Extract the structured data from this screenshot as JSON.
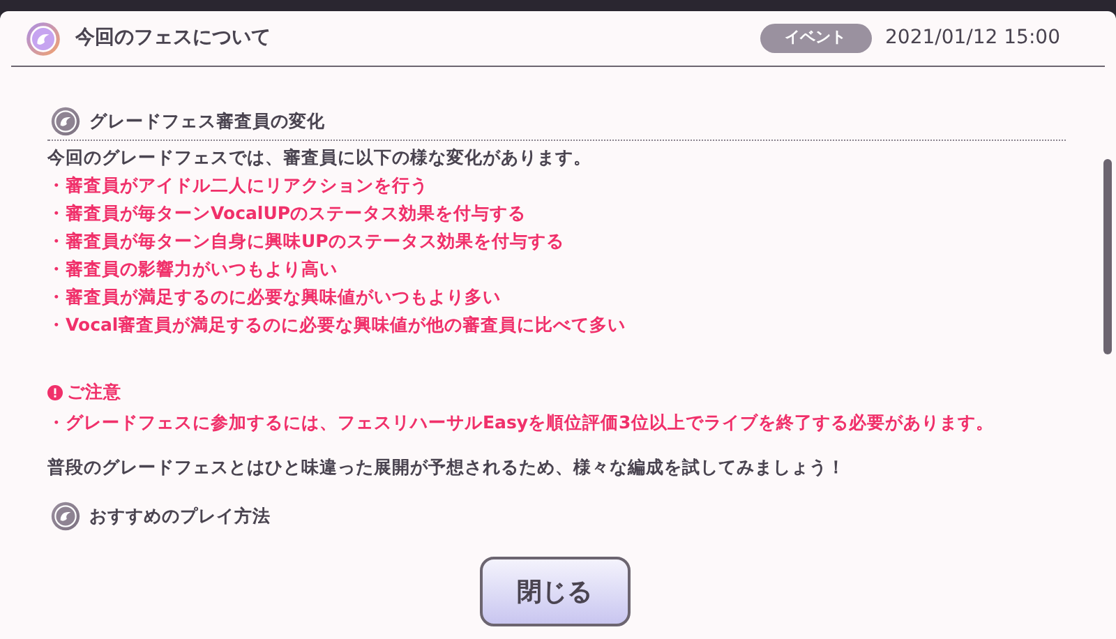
{
  "header": {
    "title": "今回のフェスについて",
    "tag": "イベント",
    "datetime": "2021/01/12 15:00"
  },
  "section": {
    "heading": "グレードフェス審査員の変化",
    "intro": "今回のグレードフェスでは、審査員に以下の様な変化があります。",
    "bullets": [
      "・審査員がアイドル二人にリアクションを行う",
      "・審査員が毎ターンVocalUPのステータス効果を付与する",
      "・審査員が毎ターン自身に興味UPのステータス効果を付与する",
      "・審査員の影響力がいつもより高い",
      "・審査員が満足するのに必要な興味値がいつもより多い",
      "・Vocal審査員が満足するのに必要な興味値が他の審査員に比べて多い"
    ]
  },
  "notice": {
    "title": "ご注意",
    "bullets": [
      "・グレードフェスに参加するには、フェスリハーサルEasyを順位評価3位以上でライブを終了する必要があります。"
    ]
  },
  "closing": "普段のグレードフェスとはひと味違った展開が予想されるため、様々な編成を試してみましょう！",
  "next_heading": "おすすめのプレイ方法",
  "close_button": "閉じる"
}
